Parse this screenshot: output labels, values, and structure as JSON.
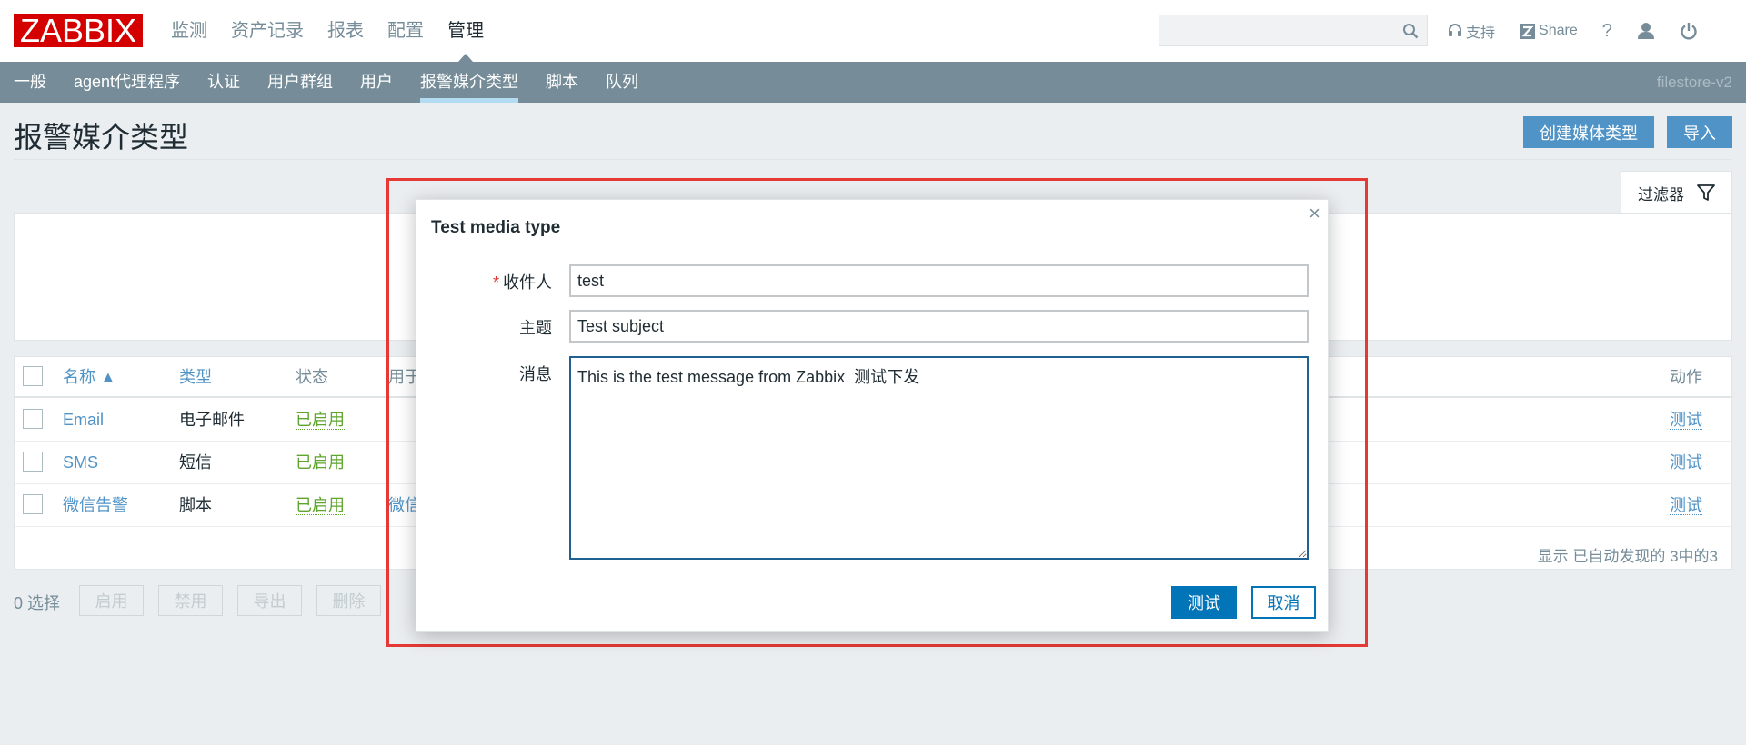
{
  "header": {
    "logo": "ZABBIX",
    "nav": [
      "监测",
      "资产记录",
      "报表",
      "配置",
      "管理"
    ],
    "search_placeholder": "",
    "support_label": "支持",
    "share_label": "Share",
    "help_label": "?"
  },
  "subnav": {
    "items": [
      "一般",
      "agent代理程序",
      "认证",
      "用户群组",
      "用户",
      "报警媒介类型",
      "脚本",
      "队列"
    ],
    "active_index": 5,
    "server_name": "filestore-v2"
  },
  "page": {
    "title": "报警媒介类型",
    "create_button": "创建媒体类型",
    "import_button": "导入",
    "filter_label": "过滤器"
  },
  "table": {
    "columns": {
      "name": "名称 ▲",
      "type": "类型",
      "status": "状态",
      "used_in": "用于",
      "actions": "动作"
    },
    "rows": [
      {
        "name": "Email",
        "type": "电子邮件",
        "status": "已启用",
        "used_in": "",
        "action": "测试"
      },
      {
        "name": "SMS",
        "type": "短信",
        "status": "已启用",
        "used_in": "",
        "action": "测试"
      },
      {
        "name": "微信告警",
        "type": "脚本",
        "status": "已启用",
        "used_in": "微信",
        "action": "测试"
      }
    ],
    "footer": "显示 已自动发现的 3中的3"
  },
  "bulk": {
    "selected": "0 选择",
    "buttons": [
      "启用",
      "禁用",
      "导出",
      "删除"
    ]
  },
  "modal": {
    "title": "Test media type",
    "close": "×",
    "fields": {
      "recipient_label": "收件人",
      "recipient_value": "test",
      "subject_label": "主题",
      "subject_value": "Test subject",
      "message_label": "消息",
      "message_value": "This is the test message from Zabbix  测试下发"
    },
    "test_button": "测试",
    "cancel_button": "取消"
  },
  "colors": {
    "brand": "#d40000",
    "subnav": "#768d99",
    "link": "#5093c6",
    "enabled": "#5ea42d",
    "primary": "#0275b8",
    "highlight_frame": "#e53935"
  }
}
